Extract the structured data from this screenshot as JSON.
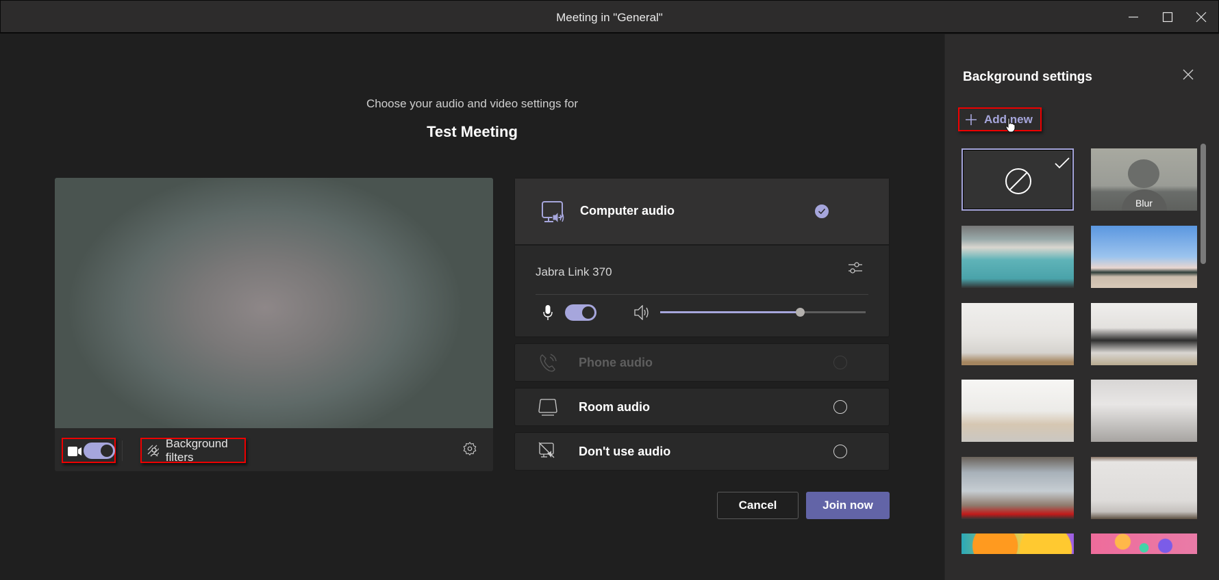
{
  "window": {
    "title": "Meeting in \"General\"",
    "controls": [
      "minimize",
      "maximize",
      "close"
    ]
  },
  "prejoin": {
    "subtitle": "Choose your audio and video settings for",
    "meeting_title": "Test Meeting",
    "video_toolbar": {
      "camera_on": true,
      "background_filters_label": "Background filters",
      "settings_icon": "gear-icon"
    }
  },
  "audio": {
    "options": [
      {
        "id": "computer",
        "label": "Computer audio",
        "icon": "computer-speaker-icon",
        "selected": true,
        "disabled": false
      },
      {
        "id": "phone",
        "label": "Phone audio",
        "icon": "phone-icon",
        "selected": false,
        "disabled": true
      },
      {
        "id": "room",
        "label": "Room audio",
        "icon": "room-device-icon",
        "selected": false,
        "disabled": false
      },
      {
        "id": "none",
        "label": "Don't use audio",
        "icon": "no-audio-icon",
        "selected": false,
        "disabled": false
      }
    ],
    "device_name": "Jabra Link 370",
    "mic_on": true,
    "speaker_volume_pct": 68
  },
  "actions": {
    "cancel_label": "Cancel",
    "join_label": "Join now"
  },
  "background_settings": {
    "title": "Background settings",
    "add_new_label": "Add new",
    "tiles": [
      {
        "name": "none",
        "label": "",
        "selected": true
      },
      {
        "name": "blur",
        "label": "Blur",
        "selected": false
      },
      {
        "name": "office-lockers",
        "label": "",
        "selected": false
      },
      {
        "name": "beach-lifeguard-tower",
        "label": "",
        "selected": false
      },
      {
        "name": "white-loft-window",
        "label": "",
        "selected": false
      },
      {
        "name": "white-room-mirror",
        "label": "",
        "selected": false
      },
      {
        "name": "bright-staircase-room",
        "label": "",
        "selected": false
      },
      {
        "name": "white-studio",
        "label": "",
        "selected": false
      },
      {
        "name": "city-view-lounge",
        "label": "",
        "selected": false
      },
      {
        "name": "white-wall-office",
        "label": "",
        "selected": false
      },
      {
        "name": "orange-bubbles",
        "label": "",
        "selected": false
      },
      {
        "name": "pink-bubbles",
        "label": "",
        "selected": false
      }
    ]
  }
}
